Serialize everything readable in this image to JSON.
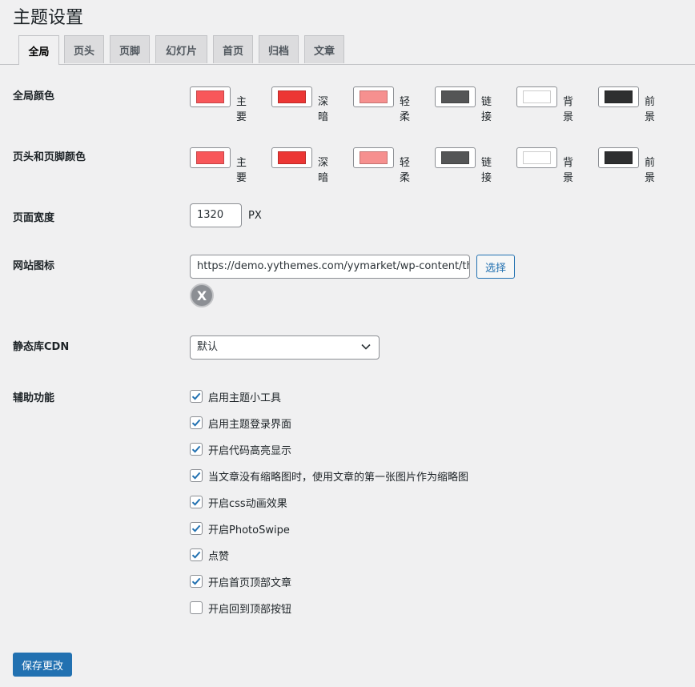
{
  "page": {
    "title": "主题设置"
  },
  "tabs": [
    {
      "label": "全局",
      "active": true
    },
    {
      "label": "页头",
      "active": false
    },
    {
      "label": "页脚",
      "active": false
    },
    {
      "label": "幻灯片",
      "active": false
    },
    {
      "label": "首页",
      "active": false
    },
    {
      "label": "归档",
      "active": false
    },
    {
      "label": "文章",
      "active": false
    }
  ],
  "global_colors": {
    "label": "全局颜色",
    "swatches": [
      {
        "label": "主要",
        "color": "#f8575a"
      },
      {
        "label": "深暗",
        "color": "#ec3634"
      },
      {
        "label": "轻柔",
        "color": "#f6908f"
      },
      {
        "label": "链接",
        "color": "#545556"
      },
      {
        "label": "背景",
        "color": "#ffffff"
      },
      {
        "label": "前景",
        "color": "#2e2f30"
      }
    ]
  },
  "header_footer_colors": {
    "label": "页头和页脚颜色",
    "swatches": [
      {
        "label": "主要",
        "color": "#f8575a"
      },
      {
        "label": "深暗",
        "color": "#ec3634"
      },
      {
        "label": "轻柔",
        "color": "#f6908f"
      },
      {
        "label": "链接",
        "color": "#545556"
      },
      {
        "label": "背景",
        "color": "#ffffff"
      },
      {
        "label": "前景",
        "color": "#2e2f30"
      }
    ]
  },
  "page_width": {
    "label": "页面宽度",
    "value": "1320",
    "unit": "PX"
  },
  "site_icon": {
    "label": "网站图标",
    "value": "https://demo.yythemes.com/yymarket/wp-content/themes",
    "choose_label": "选择",
    "remove_glyph": "X"
  },
  "cdn": {
    "label": "静态库CDN",
    "selected": "默认"
  },
  "accessibility": {
    "label": "辅助功能",
    "options": [
      {
        "label": "启用主题小工具",
        "checked": true
      },
      {
        "label": "启用主题登录界面",
        "checked": true
      },
      {
        "label": "开启代码高亮显示",
        "checked": true
      },
      {
        "label": "当文章没有缩略图时，使用文章的第一张图片作为缩略图",
        "checked": true
      },
      {
        "label": "开启css动画效果",
        "checked": true
      },
      {
        "label": "开启PhotoSwipe",
        "checked": true
      },
      {
        "label": "点赞",
        "checked": true
      },
      {
        "label": "开启首页顶部文章",
        "checked": true
      },
      {
        "label": "开启回到顶部按钮",
        "checked": false
      }
    ]
  },
  "save": {
    "label": "保存更改"
  },
  "theme": {
    "accent": "#2271b1",
    "check": "#2271b1"
  }
}
